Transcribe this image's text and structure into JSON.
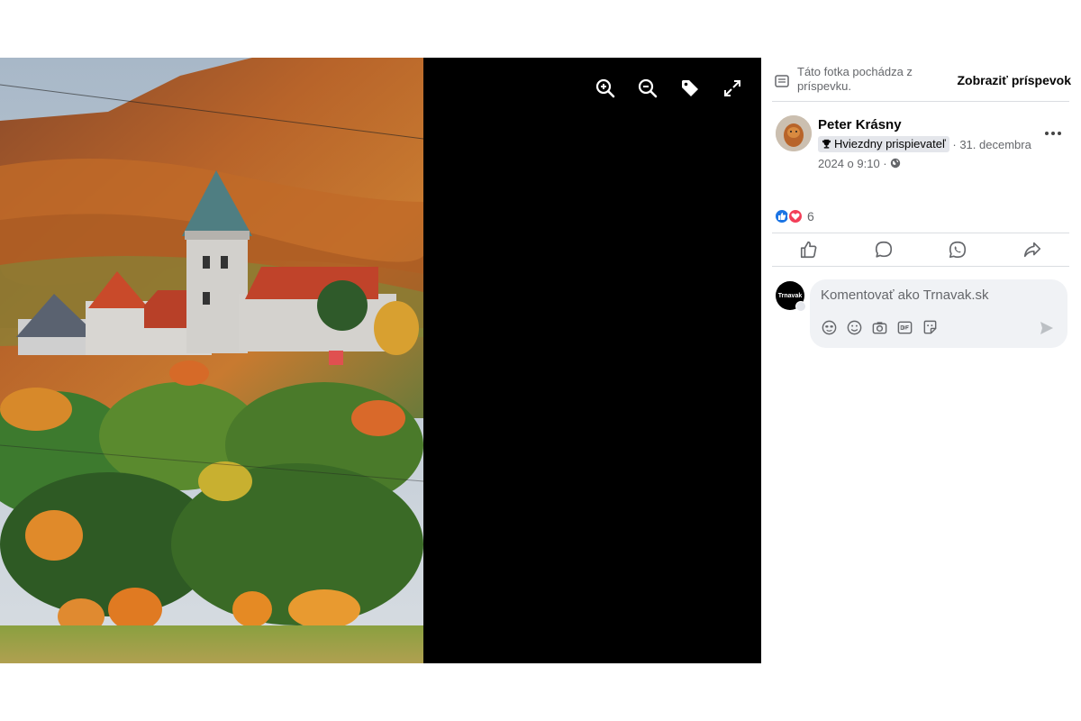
{
  "viewer": {
    "zoom_in_icon": "zoom-in-icon",
    "zoom_out_icon": "zoom-out-icon",
    "tag_icon": "tag-icon",
    "fullscreen_icon": "fullscreen-icon"
  },
  "panel": {
    "source_text": "Táto fotka pochádza z príspevku.",
    "view_post_label": "Zobraziť príspevok",
    "author": {
      "name": "Peter Krásny",
      "badge": "Hviezdny prispievateľ",
      "date": "· 31. decembra 2024 o 9:10 ·"
    },
    "reactions": {
      "count": "6",
      "types": [
        "like",
        "love"
      ]
    },
    "actions": [
      "like",
      "comment",
      "whatsapp",
      "share"
    ],
    "commenter_avatar_text": "Trnavak",
    "comment_placeholder": "Komentovať ako Trnavak.sk"
  },
  "colors": {
    "like_blue": "#1b74e4",
    "love_red": "#f33e58",
    "stage_bg": "#000000"
  }
}
